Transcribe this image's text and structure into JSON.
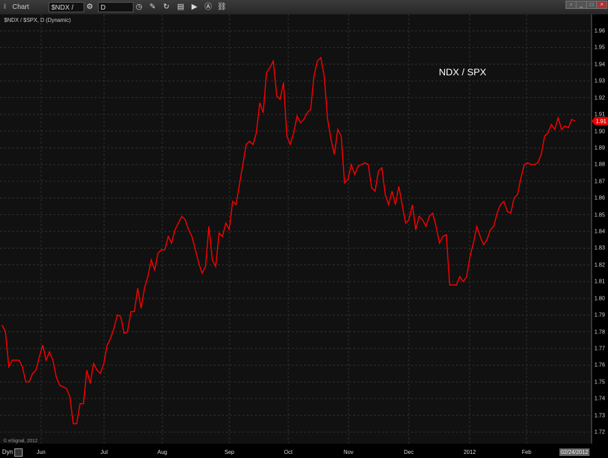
{
  "window": {
    "title": "Chart",
    "symbol_field": "$NDX / $S",
    "interval_field": "D",
    "header_label": "$NDX / $SPX, D (Dynamic)",
    "copyright": "© eSignal, 2012",
    "dyn_label": "Dyn",
    "current_date": "02/24/2012"
  },
  "chart_data": {
    "type": "line",
    "title": "",
    "annotation": "NDX / SPX",
    "x_tick_labels": [
      "Jun",
      "Jul",
      "Aug",
      "Sep",
      "Oct",
      "Nov",
      "Dec",
      "2012",
      "Feb"
    ],
    "y_ticks": [
      "1.96",
      "1.95",
      "1.94",
      "1.93",
      "1.92",
      "1.91",
      "1.90",
      "1.89",
      "1.88",
      "1.87",
      "1.86",
      "1.85",
      "1.84",
      "1.83",
      "1.82",
      "1.81",
      "1.80",
      "1.79",
      "1.78",
      "1.77",
      "1.76",
      "1.75",
      "1.74",
      "1.73",
      "1.72"
    ],
    "ylim": [
      1.72,
      1.96
    ],
    "last_value_label": "1.91",
    "grid": true,
    "line_color": "#ff0000",
    "series": [
      {
        "values": [
          1.784,
          1.78,
          1.759,
          1.763,
          1.763,
          1.763,
          1.759,
          1.75,
          1.75,
          1.755,
          1.757,
          1.765,
          1.772,
          1.763,
          1.768,
          1.763,
          1.753,
          1.748,
          1.747,
          1.746,
          1.741,
          1.725,
          1.725,
          1.737,
          1.737,
          1.757,
          1.749,
          1.761,
          1.757,
          1.755,
          1.761,
          1.772,
          1.776,
          1.782,
          1.79,
          1.789,
          1.779,
          1.78,
          1.792,
          1.792,
          1.806,
          1.794,
          1.806,
          1.813,
          1.823,
          1.817,
          1.827,
          1.829,
          1.829,
          1.837,
          1.833,
          1.841,
          1.845,
          1.849,
          1.847,
          1.841,
          1.837,
          1.829,
          1.821,
          1.815,
          1.819,
          1.843,
          1.823,
          1.819,
          1.839,
          1.837,
          1.845,
          1.841,
          1.858,
          1.856,
          1.868,
          1.88,
          1.892,
          1.894,
          1.892,
          1.899,
          1.917,
          1.911,
          1.935,
          1.938,
          1.942,
          1.921,
          1.919,
          1.929,
          1.897,
          1.892,
          1.899,
          1.909,
          1.905,
          1.907,
          1.911,
          1.913,
          1.933,
          1.942,
          1.944,
          1.933,
          1.907,
          1.895,
          1.886,
          1.901,
          1.897,
          1.869,
          1.871,
          1.88,
          1.874,
          1.879,
          1.88,
          1.881,
          1.88,
          1.866,
          1.864,
          1.876,
          1.878,
          1.862,
          1.856,
          1.864,
          1.856,
          1.867,
          1.856,
          1.845,
          1.847,
          1.856,
          1.841,
          1.849,
          1.847,
          1.843,
          1.849,
          1.851,
          1.843,
          1.833,
          1.837,
          1.838,
          1.808,
          1.808,
          1.808,
          1.813,
          1.81,
          1.813,
          1.825,
          1.833,
          1.843,
          1.837,
          1.832,
          1.835,
          1.841,
          1.843,
          1.851,
          1.856,
          1.858,
          1.852,
          1.851,
          1.86,
          1.862,
          1.872,
          1.88,
          1.881,
          1.88,
          1.88,
          1.881,
          1.886,
          1.897,
          1.899,
          1.904,
          1.901,
          1.908,
          1.901,
          1.903,
          1.902,
          1.907,
          1.906
        ]
      }
    ]
  }
}
